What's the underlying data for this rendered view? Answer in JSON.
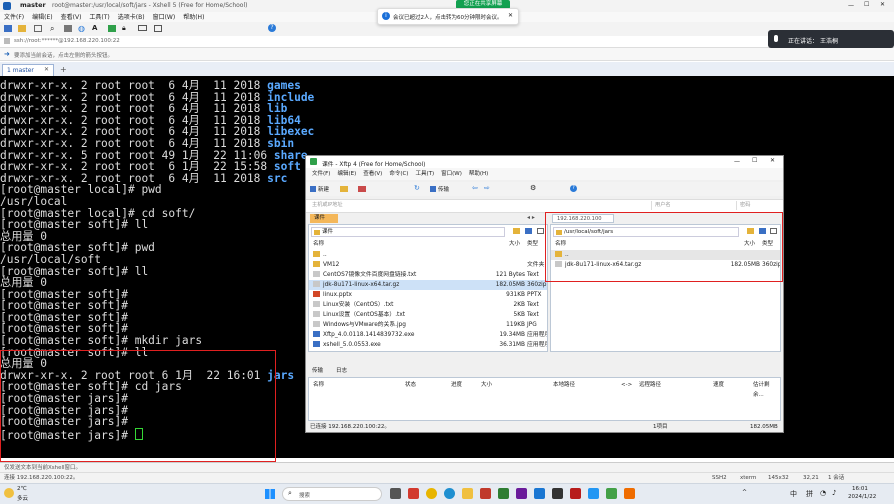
{
  "xshell": {
    "title": "root@master:/usr/local/soft/jars - Xshell 5 (Free for Home/School)",
    "host_badge": "master",
    "menu": [
      "文件(F)",
      "编辑(E)",
      "查看(V)",
      "工具(T)",
      "选项卡(B)",
      "窗口(W)",
      "帮助(H)"
    ],
    "address": "ssh://root:******@192.168.220.100:22",
    "hint": "要添加当前会话，点击左侧的箭头按钮。",
    "tab_label": "1 master",
    "status_left": "ssh://root@192.168.220.100:22",
    "status2": "连接 192.168.220.100:22。",
    "status_right": [
      "SSH2",
      "xterm",
      "145x32",
      "32,21",
      "1 会话"
    ],
    "input_hint": "仅发送文本到当前Xshell窗口。"
  },
  "terminal": {
    "lines": [
      {
        "text": "drwxr-xr-x. 2 root root  6 4月  11 2018 ",
        "dir": "games"
      },
      {
        "text": "drwxr-xr-x. 2 root root  6 4月  11 2018 ",
        "dir": "include"
      },
      {
        "text": "drwxr-xr-x. 2 root root  6 4月  11 2018 ",
        "dir": "lib"
      },
      {
        "text": "drwxr-xr-x. 2 root root  6 4月  11 2018 ",
        "dir": "lib64"
      },
      {
        "text": "drwxr-xr-x. 2 root root  6 4月  11 2018 ",
        "dir": "libexec"
      },
      {
        "text": "drwxr-xr-x. 2 root root  6 4月  11 2018 ",
        "dir": "sbin"
      },
      {
        "text": "drwxr-xr-x. 5 root root 49 1月  22 11:06 ",
        "dir": "share"
      },
      {
        "text": "drwxr-xr-x. 2 root root  6 1月  22 15:58 ",
        "dir": "soft"
      },
      {
        "text": "drwxr-xr-x. 2 root root  6 4月  11 2018 ",
        "dir": "src"
      },
      {
        "text": "[root@master local]# pwd",
        "dir": ""
      },
      {
        "text": "/usr/local",
        "dir": ""
      },
      {
        "text": "[root@master local]# cd soft/",
        "dir": ""
      },
      {
        "text": "[root@master soft]# ll",
        "dir": ""
      },
      {
        "text": "总用量 0",
        "dir": ""
      },
      {
        "text": "[root@master soft]# pwd",
        "dir": ""
      },
      {
        "text": "/usr/local/soft",
        "dir": ""
      },
      {
        "text": "[root@master soft]# ll",
        "dir": ""
      },
      {
        "text": "总用量 0",
        "dir": ""
      },
      {
        "text": "[root@master soft]#",
        "dir": ""
      },
      {
        "text": "[root@master soft]#",
        "dir": ""
      },
      {
        "text": "[root@master soft]#",
        "dir": ""
      },
      {
        "text": "[root@master soft]#",
        "dir": ""
      },
      {
        "text": "[root@master soft]# mkdir jars",
        "dir": ""
      },
      {
        "text": "[root@master soft]# ll",
        "dir": ""
      },
      {
        "text": "总用量 0",
        "dir": ""
      },
      {
        "text": "drwxr-xr-x. 2 root root 6 1月  22 16:01 ",
        "dir": "jars"
      },
      {
        "text": "[root@master soft]# cd jars",
        "dir": ""
      },
      {
        "text": "[root@master jars]#",
        "dir": ""
      },
      {
        "text": "[root@master jars]#",
        "dir": ""
      },
      {
        "text": "[root@master jars]#",
        "dir": ""
      },
      {
        "text": "[root@master jars]# ",
        "dir": ""
      }
    ]
  },
  "notification": {
    "text": "会议已超过2人，点击转为60分钟限时会议。",
    "meeting_badge": "您正在共享屏幕",
    "speaking_label": "正在讲话：",
    "speaker": "王浩桐"
  },
  "xftp": {
    "title": "课件 - Xftp 4 (Free for Home/School)",
    "menu": [
      "文件(F)",
      "编辑(E)",
      "查看(V)",
      "命令(C)",
      "工具(T)",
      "窗口(W)",
      "帮助(H)"
    ],
    "new_label": "新建",
    "sync_label": "传输",
    "addr_placeholder": "主机或IP地址",
    "user_placeholder": "用户名",
    "pass_placeholder": "密码",
    "left_tab": "课件",
    "right_tab": "192.168.220.100",
    "left_path": "课件",
    "right_path": "/usr/local/soft/jars",
    "left_columns": [
      "名称",
      "大小",
      "类型"
    ],
    "right_columns": [
      "名称",
      "大小",
      "类型"
    ],
    "left_files": [
      {
        "name": "..",
        "size": "",
        "type": ""
      },
      {
        "name": "VM12",
        "size": "",
        "type": "文件夹"
      },
      {
        "name": "CentOS7镜像文件百度网盘链接.txt",
        "size": "121 Bytes",
        "type": "Text"
      },
      {
        "name": "jdk-8u171-linux-x64.tar.gz",
        "size": "182.05MB",
        "type": "360zip"
      },
      {
        "name": "linux.pptx",
        "size": "931KB",
        "type": "PPTX"
      },
      {
        "name": "Linux安装（CentOS）.txt",
        "size": "2KB",
        "type": "Text"
      },
      {
        "name": "Linux设置（CentOS基本）.txt",
        "size": "5KB",
        "type": "Text"
      },
      {
        "name": "Windows与VMware的关系.jpg",
        "size": "119KB",
        "type": "JPG"
      },
      {
        "name": "Xftp_4.0.0118.1414839732.exe",
        "size": "19.34MB",
        "type": "应用程序"
      },
      {
        "name": "xshell_5.0.0553.exe",
        "size": "36.31MB",
        "type": "应用程序"
      }
    ],
    "right_files": [
      {
        "name": "..",
        "size": "",
        "type": ""
      },
      {
        "name": "jdk-8u171-linux-x64.tar.gz",
        "size": "182.05MB",
        "type": "360zip"
      }
    ],
    "transfer_tabs": [
      "传输",
      "日志"
    ],
    "transfer_columns": [
      "名称",
      "状态",
      "进度",
      "大小",
      "本地路径",
      "<->",
      "远程路径",
      "速度",
      "估计剩余..."
    ],
    "status_left": "已连接 192.168.220.100:22。",
    "status_mid": "1项目",
    "status_right": "182.05MB"
  },
  "taskbar": {
    "weather_temp": "2℃",
    "weather_desc": "多云",
    "search_placeholder": "搜索",
    "tray": [
      "^",
      "中",
      "拼"
    ],
    "time": "16:01",
    "date": "2024/1/22"
  }
}
